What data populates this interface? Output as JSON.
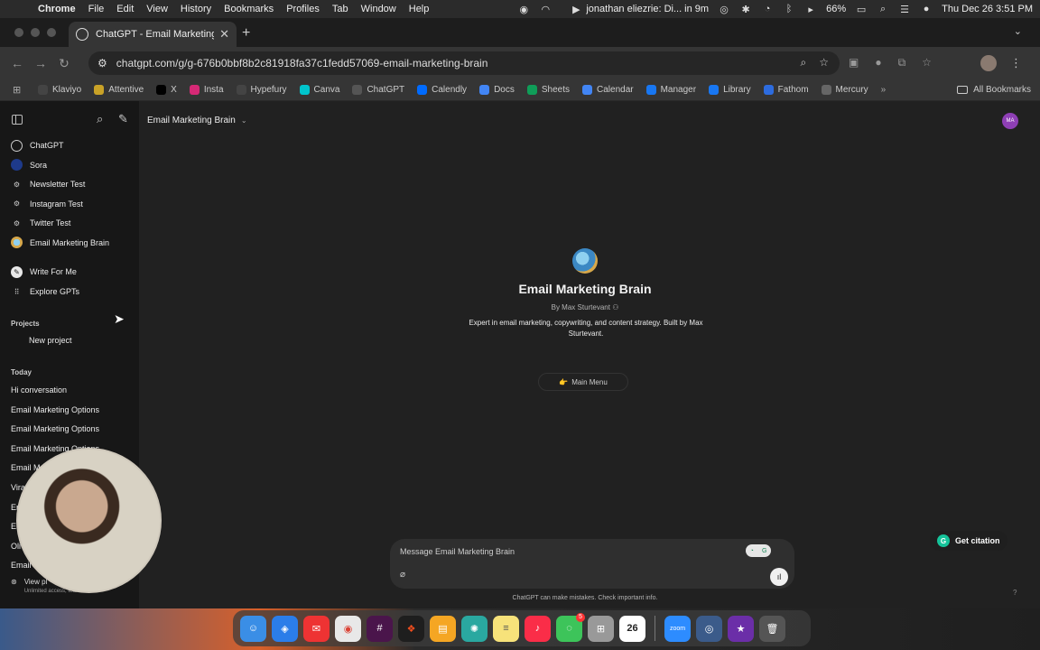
{
  "menubar": {
    "app_name": "Chrome",
    "items": [
      "File",
      "Edit",
      "View",
      "History",
      "Bookmarks",
      "Profiles",
      "Tab",
      "Window",
      "Help"
    ],
    "notification": "jonathan eliezrie: Di... in 9m",
    "battery": "66%",
    "datetime": "Thu Dec 26  3:51 PM"
  },
  "browser": {
    "tab_title": "ChatGPT - Email Marketing B",
    "url": "chatgpt.com/g/g-676b0bbf8b2c81918fa37c1fedd57069-email-marketing-brain",
    "bookmarks": [
      {
        "label": "Klaviyo",
        "color": "#444444"
      },
      {
        "label": "Attentive",
        "color": "#c9a227"
      },
      {
        "label": "X",
        "color": "#000000"
      },
      {
        "label": "Insta",
        "color": "#d62976"
      },
      {
        "label": "Hypefury",
        "color": "#444444"
      },
      {
        "label": "Canva",
        "color": "#00c4cc"
      },
      {
        "label": "ChatGPT",
        "color": "#555555"
      },
      {
        "label": "Calendly",
        "color": "#006bff"
      },
      {
        "label": "Docs",
        "color": "#4285f4"
      },
      {
        "label": "Sheets",
        "color": "#0f9d58"
      },
      {
        "label": "Calendar",
        "color": "#4285f4"
      },
      {
        "label": "Manager",
        "color": "#1877f2"
      },
      {
        "label": "Library",
        "color": "#1877f2"
      },
      {
        "label": "Fathom",
        "color": "#2d6cdf"
      },
      {
        "label": "Mercury",
        "color": "#666666"
      }
    ],
    "all_bookmarks": "All Bookmarks"
  },
  "sidebar": {
    "gpts": [
      {
        "label": "ChatGPT",
        "icon": "chatgpt-icon"
      },
      {
        "label": "Sora",
        "icon": "sora-icon"
      },
      {
        "label": "Newsletter Test",
        "icon": "gpt-icon"
      },
      {
        "label": "Instagram Test",
        "icon": "gpt-icon"
      },
      {
        "label": "Twitter Test",
        "icon": "gpt-icon"
      },
      {
        "label": "Email Marketing Brain",
        "icon": "globe-icon"
      }
    ],
    "write_for_me": "Write For Me",
    "explore": "Explore GPTs",
    "projects_label": "Projects",
    "new_project": "New project",
    "today_label": "Today",
    "history": [
      "Hi conversation",
      "Email Marketing Options",
      "Email Marketing Options",
      "Email Marketing Options",
      "Email M",
      "Vira",
      "Em",
      "Em",
      "Oli",
      "Email"
    ],
    "view_plans": "View pl",
    "view_plans_sub": "Unlimited access, team..."
  },
  "header": {
    "title": "Email Marketing Brain",
    "avatar_initials": "MA"
  },
  "gpt": {
    "name": "Email Marketing Brain",
    "author": "By Max Sturtevant",
    "description": "Expert in email marketing, copywriting, and content strategy. Built by Max Sturtevant.",
    "starter": "Main Menu",
    "starter_emoji": "👉"
  },
  "composer": {
    "placeholder": "Message Email Marketing Brain",
    "disclaimer": "ChatGPT can make mistakes. Check important info."
  },
  "extension": {
    "citation_label": "Get citation"
  },
  "dock": {
    "calendar_day": "26",
    "zoom_label": "zoom"
  }
}
